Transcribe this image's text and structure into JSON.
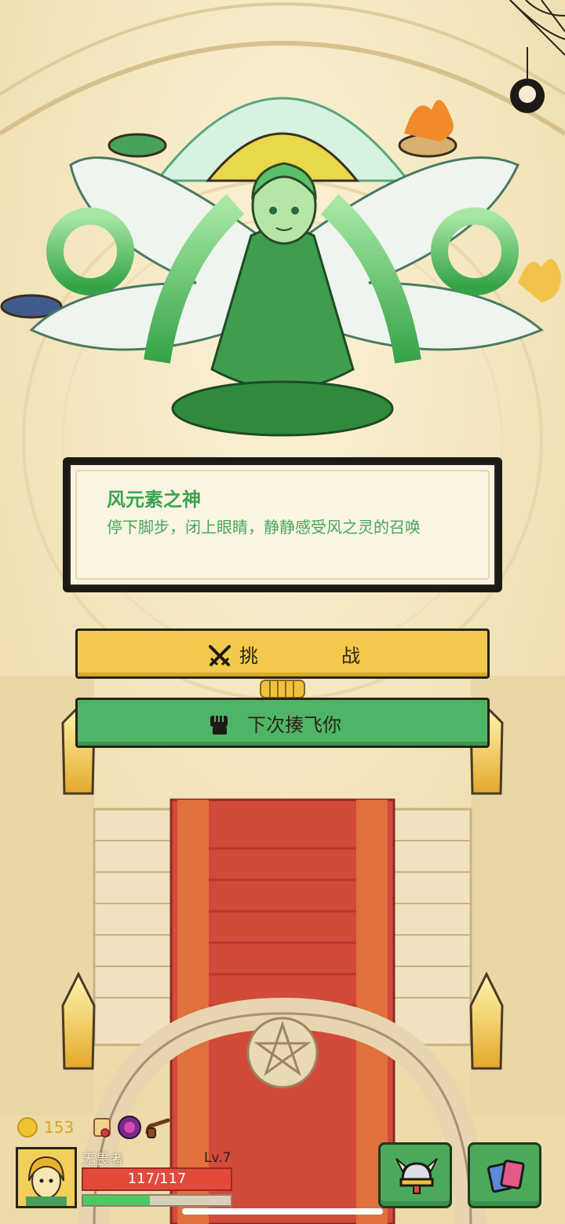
{
  "boss": {
    "name": "风元素之神",
    "description": "停下脚步，闭上眼睛，静静感受风之灵的召唤"
  },
  "actions": {
    "challenge_label_a": "挑",
    "challenge_label_b": "战",
    "challenge_icon": "crossed-swords-icon",
    "flee_label": "下次揍飞你",
    "flee_icon": "fist-icon"
  },
  "resources": {
    "coins": "153",
    "coin_icon": "coin-icon",
    "items": [
      "scroll-icon",
      "rune-orb-icon",
      "pipe-icon"
    ]
  },
  "player": {
    "name": "无畏者",
    "level": "Lv.7",
    "hp": "117/117",
    "hp_fraction": 1.0,
    "xp_fraction": 0.45
  },
  "menu_buttons": [
    {
      "icon": "viking-helmet-icon"
    },
    {
      "icon": "cards-icon"
    }
  ],
  "colors": {
    "accent_green": "#3aa34e",
    "challenge_yellow": "#f2c94c",
    "flee_green": "#4fb566",
    "hp_red": "#e24a3c"
  }
}
